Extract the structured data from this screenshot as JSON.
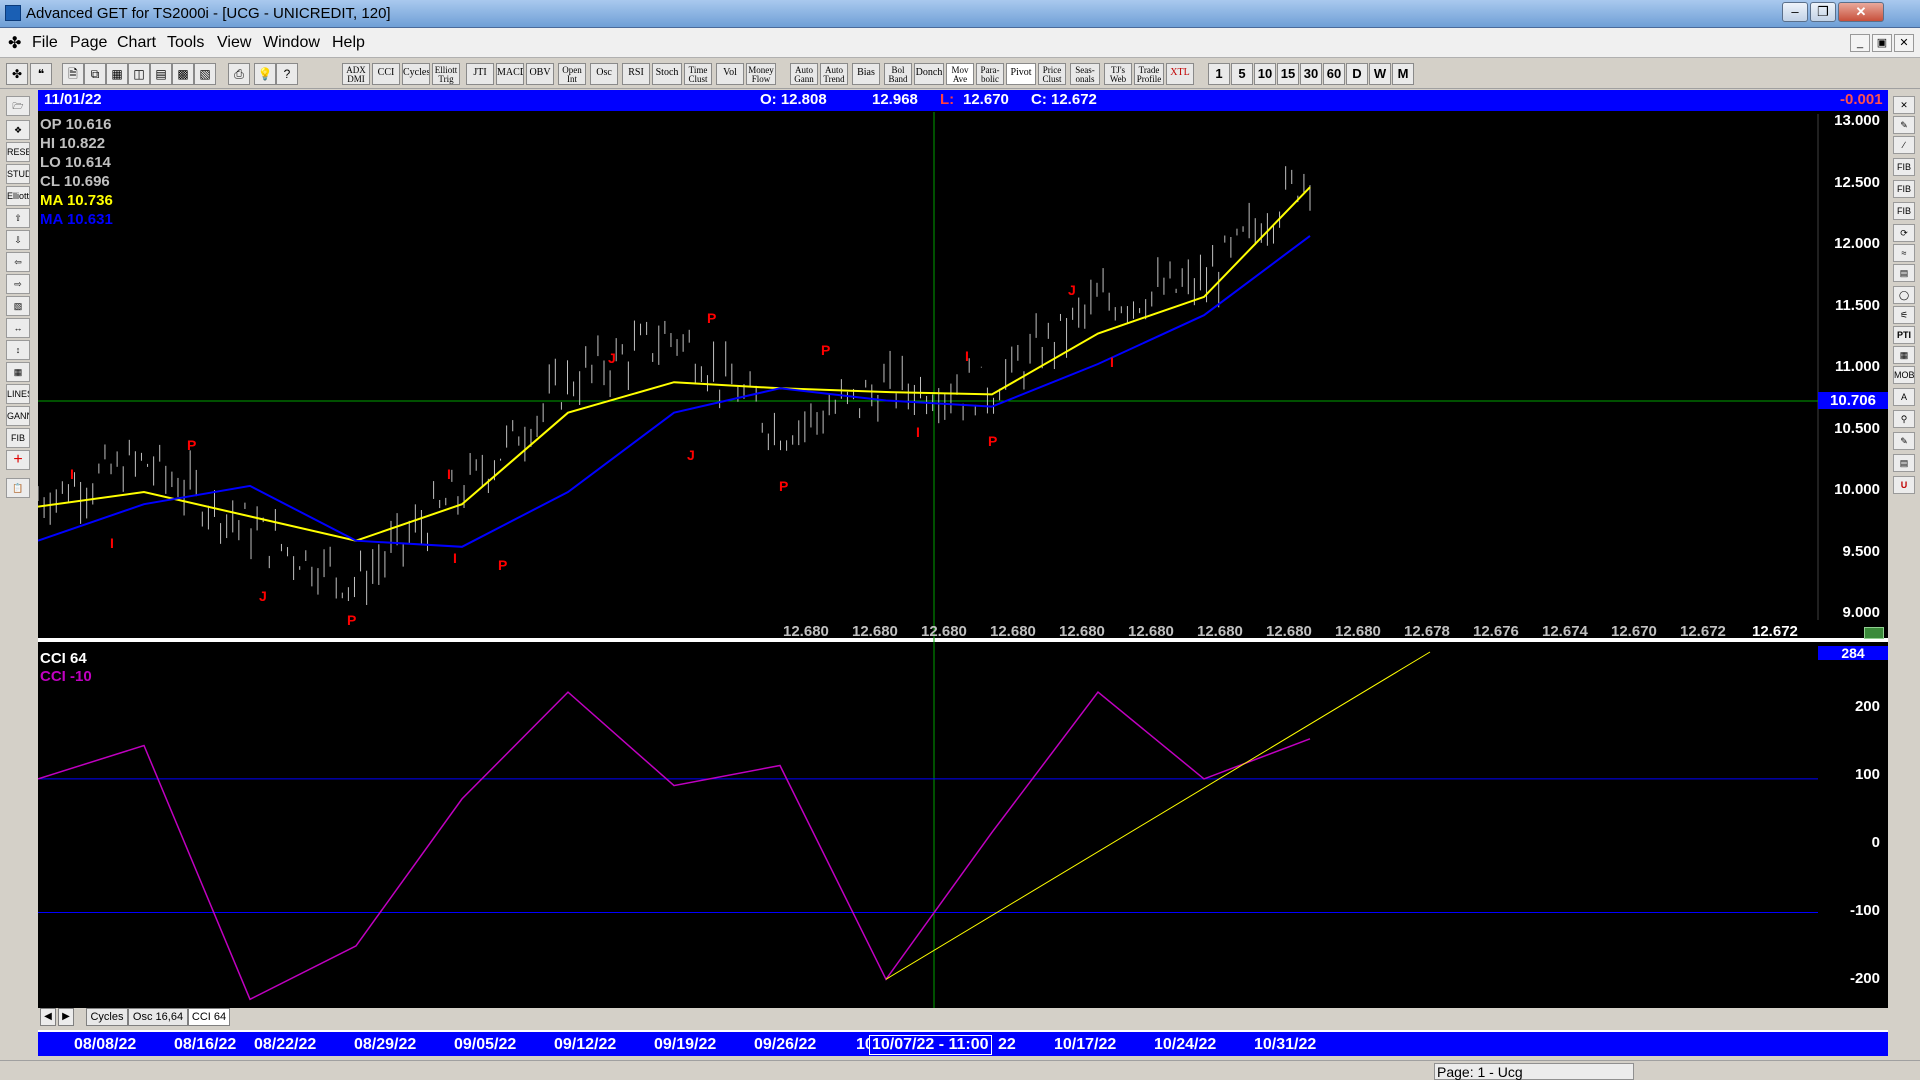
{
  "window": {
    "title": "Advanced GET for TS2000i - [UCG - UNICREDIT, 120]"
  },
  "menu": [
    "File",
    "Page",
    "Chart",
    "Tools",
    "View",
    "Window",
    "Help"
  ],
  "toolbar": {
    "studies": [
      "ADX DMI",
      "CCI",
      "Cycles",
      "Elliott Trig",
      "JTI",
      "MACD",
      "OBV",
      "Open Int",
      "Osc",
      "RSI",
      "Stoch",
      "Time Clust",
      "Vol",
      "Money Flow",
      "Auto Gann",
      "Auto Trend",
      "Bias",
      "Bol Band",
      "Donch",
      "Mov Ave",
      "Para-bolic",
      "Pivot",
      "Price Clust",
      "Seas-onals",
      "TJ's Web",
      "Trade Profile",
      "XTL"
    ],
    "intervals": [
      "1",
      "5",
      "10",
      "15",
      "30",
      "60",
      "D",
      "W",
      "M"
    ]
  },
  "infobar": {
    "date": "11/01/22",
    "open": "O: 12.808",
    "high": "12.968",
    "low_label": "L:",
    "low": "12.670",
    "close": "C: 12.672",
    "change": "-0.001"
  },
  "readout": {
    "op": "OP  10.616",
    "hi": "HI   10.822",
    "lo": "LO  10.614",
    "cl": "CL  10.696",
    "ma1": "MA  10.736",
    "ma2": "MA  10.631"
  },
  "price_axis": [
    "13.000",
    "12.500",
    "12.000",
    "11.500",
    "11.000",
    "10.500",
    "10.000",
    "9.500",
    "9.000"
  ],
  "crosshair_price": "10.706",
  "projections": [
    "12.680",
    "12.680",
    "12.680",
    "12.680",
    "12.680",
    "12.680",
    "12.680",
    "12.680",
    "12.680",
    "12.678",
    "12.676",
    "12.674",
    "12.670",
    "12.672"
  ],
  "last_price": "12.672",
  "wave_markers": [
    "I",
    "P",
    "I",
    "J",
    "P",
    "I",
    "P",
    "I",
    "J",
    "J",
    "P",
    "P",
    "P",
    "I",
    "I",
    "P",
    "J",
    "I"
  ],
  "indicator": {
    "name": "CCI 64",
    "value_label": "CCI  -10",
    "axis": [
      "200",
      "100",
      "0",
      "-100",
      "-200"
    ],
    "top_flag": "284"
  },
  "chart_data": {
    "type": "line",
    "x": [
      "08/08/22",
      "08/16/22",
      "08/22/22",
      "08/29/22",
      "09/05/22",
      "09/12/22",
      "09/19/22",
      "09/26/22",
      "10/03/22",
      "10/10/22",
      "10/17/22",
      "10/24/22",
      "10/31/22"
    ],
    "series": [
      {
        "name": "CL",
        "values": [
          9.85,
          10.15,
          9.6,
          9.15,
          9.9,
          10.8,
          11.2,
          10.4,
          10.75,
          10.75,
          11.45,
          11.6,
          12.55
        ]
      },
      {
        "name": "MA",
        "values": [
          9.78,
          9.9,
          9.7,
          9.5,
          9.8,
          10.55,
          10.8,
          10.75,
          10.72,
          10.7,
          11.2,
          11.5,
          12.4
        ]
      },
      {
        "name": "MA",
        "values": [
          9.5,
          9.8,
          9.95,
          9.5,
          9.45,
          9.9,
          10.55,
          10.75,
          10.65,
          10.6,
          10.95,
          11.35,
          12.0
        ]
      },
      {
        "name": "CCI 64",
        "values": [
          100,
          150,
          -230,
          -150,
          70,
          230,
          90,
          120,
          -200,
          20,
          230,
          100,
          160
        ]
      }
    ],
    "ylim": [
      8.85,
      13.0
    ],
    "cci_ylim": [
      -240,
      290
    ]
  },
  "tabs": [
    "Cycles",
    "Osc 16,64",
    "CCI 64"
  ],
  "date_axis": [
    "08/08/22",
    "08/16/22",
    "08/22/22",
    "08/29/22",
    "09/05/22",
    "09/12/22",
    "09/19/22",
    "09/26/22",
    "10",
    "10/07/22 - 11:00",
    "22",
    "10/17/22",
    "10/24/22",
    "10/31/22"
  ],
  "status": {
    "page": "Page: 1 - Ucg"
  },
  "colors": {
    "price_bars": "#c0c0c0",
    "ma_fast": "#ffff00",
    "ma_slow": "#0000ff",
    "cci": "#c000c0",
    "markers": "#ff0000",
    "bar_blue": "#0000ff"
  }
}
